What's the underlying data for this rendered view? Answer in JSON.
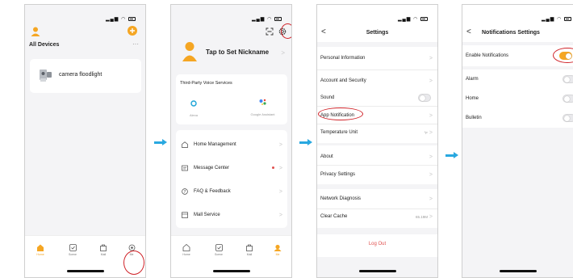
{
  "screen1": {
    "section_title": "All Devices",
    "more_label": "···",
    "device_name": "camera floodlight",
    "tabs": [
      "Home",
      "Scene",
      "Mall",
      "Me"
    ]
  },
  "screen2": {
    "nickname": "Tap to Set Nickname",
    "voice_title": "Third-Party Voice Services",
    "voice_items": [
      "Alexa",
      "Google Assistant"
    ],
    "menu": [
      "Home Management",
      "Message Center",
      "FAQ & Feedback",
      "Mall Service"
    ],
    "tabs": [
      "Home",
      "Scene",
      "Mall",
      "Me"
    ]
  },
  "screen3": {
    "title": "Settings",
    "rows": {
      "personal": "Personal Information",
      "account": "Account and Security",
      "sound": "Sound",
      "app_notification": "App Notification",
      "temp_unit": "Temperature Unit",
      "temp_value": "°F",
      "about": "About",
      "privacy": "Privacy Settings",
      "network": "Network Diagnosis",
      "clear_cache": "Clear Cache",
      "cache_size": "65.19M"
    },
    "logout": "Log Out"
  },
  "screen4": {
    "title": "Notifications Settings",
    "enable_label": "Enable Notifications",
    "items": [
      "Alarm",
      "Home",
      "Bulletin"
    ]
  },
  "colors": {
    "accent": "#f5a623",
    "highlight": "#d0242a",
    "arrow": "#29a8e0",
    "logout": "#e0504e"
  },
  "icons": [
    "signal-icon",
    "wifi-icon",
    "battery-icon",
    "avatar-icon",
    "add-icon",
    "camera-icon",
    "home-icon",
    "scene-icon",
    "mall-icon",
    "me-icon",
    "scan-icon",
    "gear-icon",
    "alexa-icon",
    "google-assistant-icon",
    "house-icon",
    "message-icon",
    "help-icon",
    "store-icon",
    "back-icon",
    "chevron-right-icon"
  ]
}
